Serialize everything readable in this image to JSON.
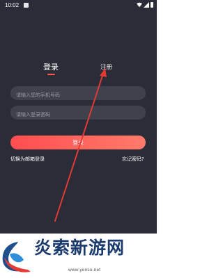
{
  "status_bar": {
    "time": "10:02"
  },
  "tabs": [
    {
      "label": "登录",
      "active": true
    },
    {
      "label": "注册",
      "active": false
    }
  ],
  "form": {
    "phone_placeholder": "请输入您的手机号码",
    "password_placeholder": "请输入登录密码",
    "login_button": "登录"
  },
  "links": {
    "switch_email": "切换为邮箱登录",
    "forgot_password": "忘记密码?"
  },
  "watermark": {
    "title": "炎索新游网",
    "url": "www.yenso.net"
  },
  "colors": {
    "background": "#2a2c37",
    "field": "#3f414c",
    "accent_start": "#ff4d50",
    "accent_end": "#ff7b6a",
    "arrow": "#e53935"
  },
  "icons": [
    "wifi-icon",
    "signal-icon",
    "battery-icon",
    "watermark-logo-icon"
  ]
}
